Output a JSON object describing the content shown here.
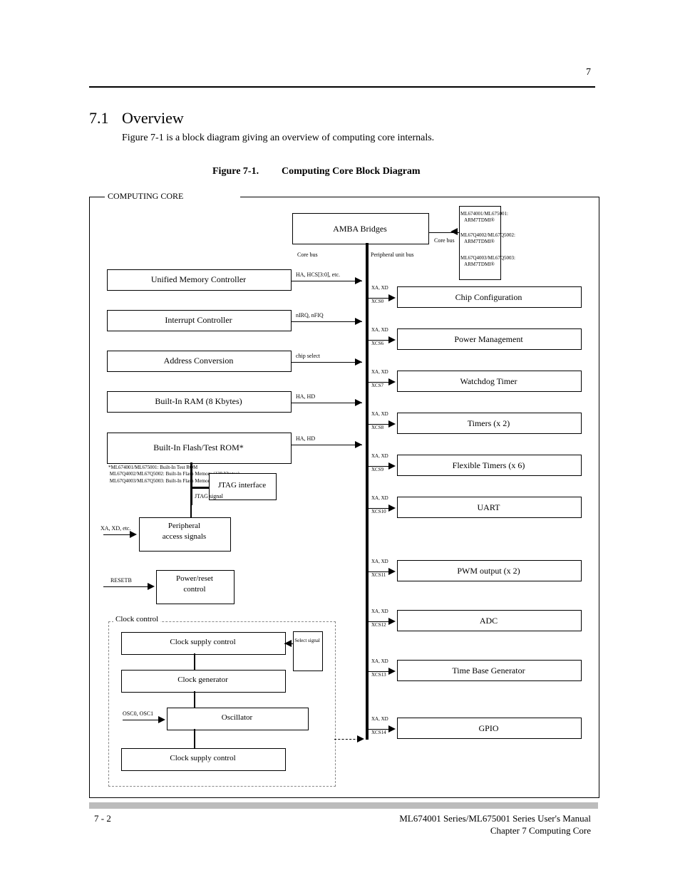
{
  "header": {
    "chapter_num": "7",
    "chapter_label": "Chapter 7"
  },
  "section": {
    "num": "7.1",
    "title": "Overview",
    "label": "Figure 7-1.",
    "caption": "Computing Core Block Diagram"
  },
  "outer_label": "COMPUTING CORE",
  "top": {
    "amba": "AMBA Bridges",
    "cpu": {
      "l1": "ML674001/ML675001: ARM7TDMI®",
      "l2": "ML67Q4002/ML67Q5002: ARM7TDMI®",
      "l3": "ML67Q4003/ML67Q5003: ARM7TDMI®",
      "note": "Core bus"
    }
  },
  "left_bus": [
    {
      "label": "Unified Memory Controller",
      "sig": "HA, HCS[3:0], etc."
    },
    {
      "label": "Interrupt Controller",
      "sig": "nIRQ, nFIQ"
    },
    {
      "label": "Address Conversion",
      "sig": "chip select"
    },
    {
      "label": "Built-In RAM (8 Kbytes)",
      "sig": "HA, HD"
    },
    {
      "label": "Built-In Flash/Test ROM*",
      "sig": "HA, HD"
    }
  ],
  "left_note": "*ML674001/ML675001: Built-In Test ROM\n ML67Q4002/ML67Q5002: Built-In Flash Memory (128 Kbytes)\n ML67Q4003/ML67Q5003: Built-In Flash Memory (256 Kbytes)",
  "aux": {
    "jtag": "JTAG interface",
    "jtag_sig": "JTAG signal",
    "xa": "Peripheral\naccess signals",
    "xa_sig": "XA, XD, etc.",
    "reset": "Power/reset\ncontrol",
    "reset_sig": "RESETB"
  },
  "right": [
    "Chip Configuration",
    "Power Management",
    "Watchdog Timer",
    "Timers (x 2)",
    "Flexible Timers (x 6)",
    "UART",
    "PWM output (x 2)",
    "ADC",
    "Time Base Generator",
    "GPIO"
  ],
  "clock": {
    "group": "Clock control",
    "supply": "Clock supply control",
    "gen": "Clock generator",
    "osc": "Oscillator",
    "sig": "OSC0, OSC1",
    "note": "Select signal",
    "bus_note": "Peripheral unit bus"
  },
  "footer": {
    "page": "7 - 2",
    "line1": "ML674001 Series/ML675001 Series User's Manual",
    "line2": "Chapter 7  Computing Core"
  },
  "right_sig": [
    "XA, XD",
    "XCS0",
    "XA, XD",
    "XCS6",
    "XA, XD",
    "XCS7",
    "XA, XD",
    "XCS8",
    "XA, XD",
    "XCS9",
    "XA, XD",
    "XCS10",
    "XA, XD",
    "XCS11",
    "XA, XD",
    "XCS12",
    "XA, XD",
    "XCS13",
    "XA, XD",
    "XCS14"
  ]
}
